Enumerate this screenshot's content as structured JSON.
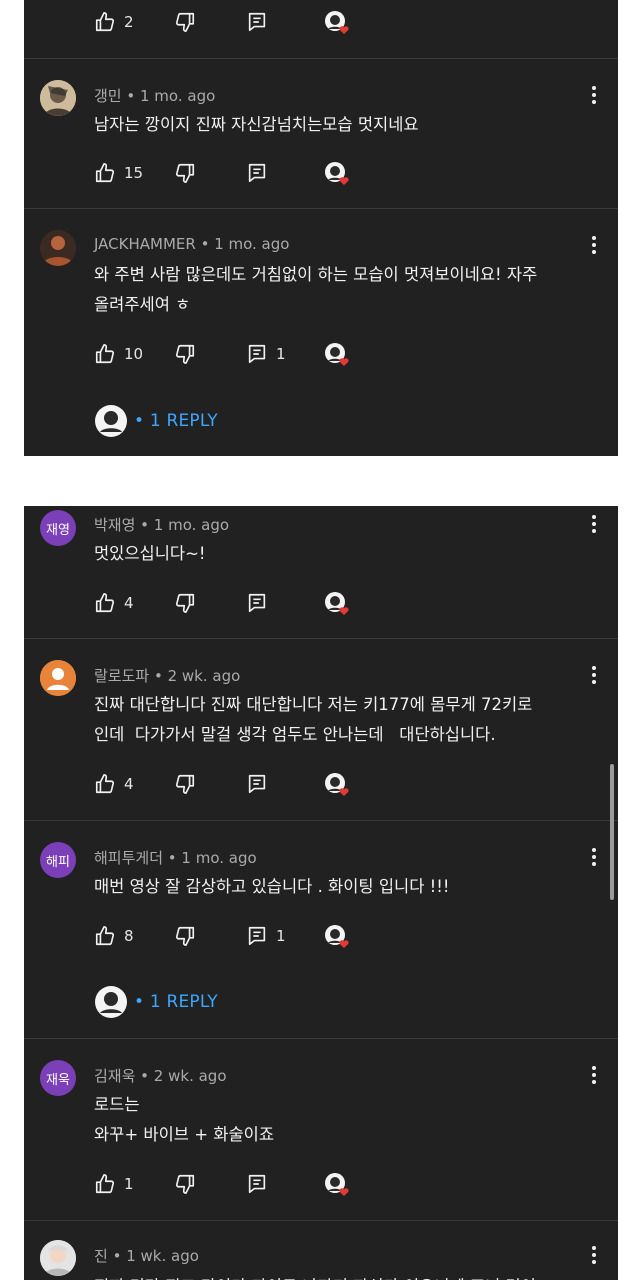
{
  "comments": [
    {
      "likes": "2"
    },
    {
      "author": "갱민",
      "time": "1 mo. ago",
      "line1": "남자는 깡이지 진짜 자신감넘치는모습 멋지네요",
      "likes": "15"
    },
    {
      "author": "JACKHAMMER",
      "time": "1 mo. ago",
      "line1": "와 주변 사람 많은데도 거침없이 하는 모습이 멋져보이네요! 자주",
      "line2": "올려주세여 ㅎ",
      "likes": "10",
      "replies": "1",
      "reply_link": "1 REPLY"
    },
    {
      "author": "박재영",
      "avatar_text": "재영",
      "avatar_color": "#7b3fb8",
      "time": "1 mo. ago",
      "line1": "멋있으십니다~!",
      "likes": "4"
    },
    {
      "author": "랄로도파",
      "avatar_color": "#e8843a",
      "time": "2 wk. ago",
      "line1": "진짜 대단합니다 진짜 대단합니다 저는 키177에 몸무게 72키로",
      "line2": "인데  다가가서 말걸 생각 엄두도 안나는데   대단하십니다.",
      "likes": "4"
    },
    {
      "author": "해피투게더",
      "avatar_text": "해피",
      "avatar_color": "#7b3fb8",
      "time": "1 mo. ago",
      "line1": "매번 영상 잘 감상하고 있습니다 . 화이팅 입니다 !!!",
      "likes": "8",
      "replies": "1",
      "reply_link": "1 REPLY"
    },
    {
      "author": "김재욱",
      "avatar_text": "재욱",
      "avatar_color": "#7b3fb8",
      "time": "2 wk. ago",
      "line1": "로드는",
      "line2": "와꾸+ 바이브 + 화술이죠",
      "likes": "1"
    },
    {
      "author": "진",
      "time": "1 wk. ago",
      "line1": "진짜 미라 진고 타이가 자이도 나자기 자신가 이으니께 조니 멋이"
    }
  ],
  "sep": " • ",
  "icons": [
    "like-icon",
    "dislike-icon",
    "reply-icon",
    "kebab-icon",
    "creator-heart-icon"
  ],
  "colors": {
    "background": "#212121",
    "text": "#f1f1f1",
    "meta": "#aaaaaa",
    "reply_link": "#3ea6ff",
    "heart": "#e53935"
  }
}
